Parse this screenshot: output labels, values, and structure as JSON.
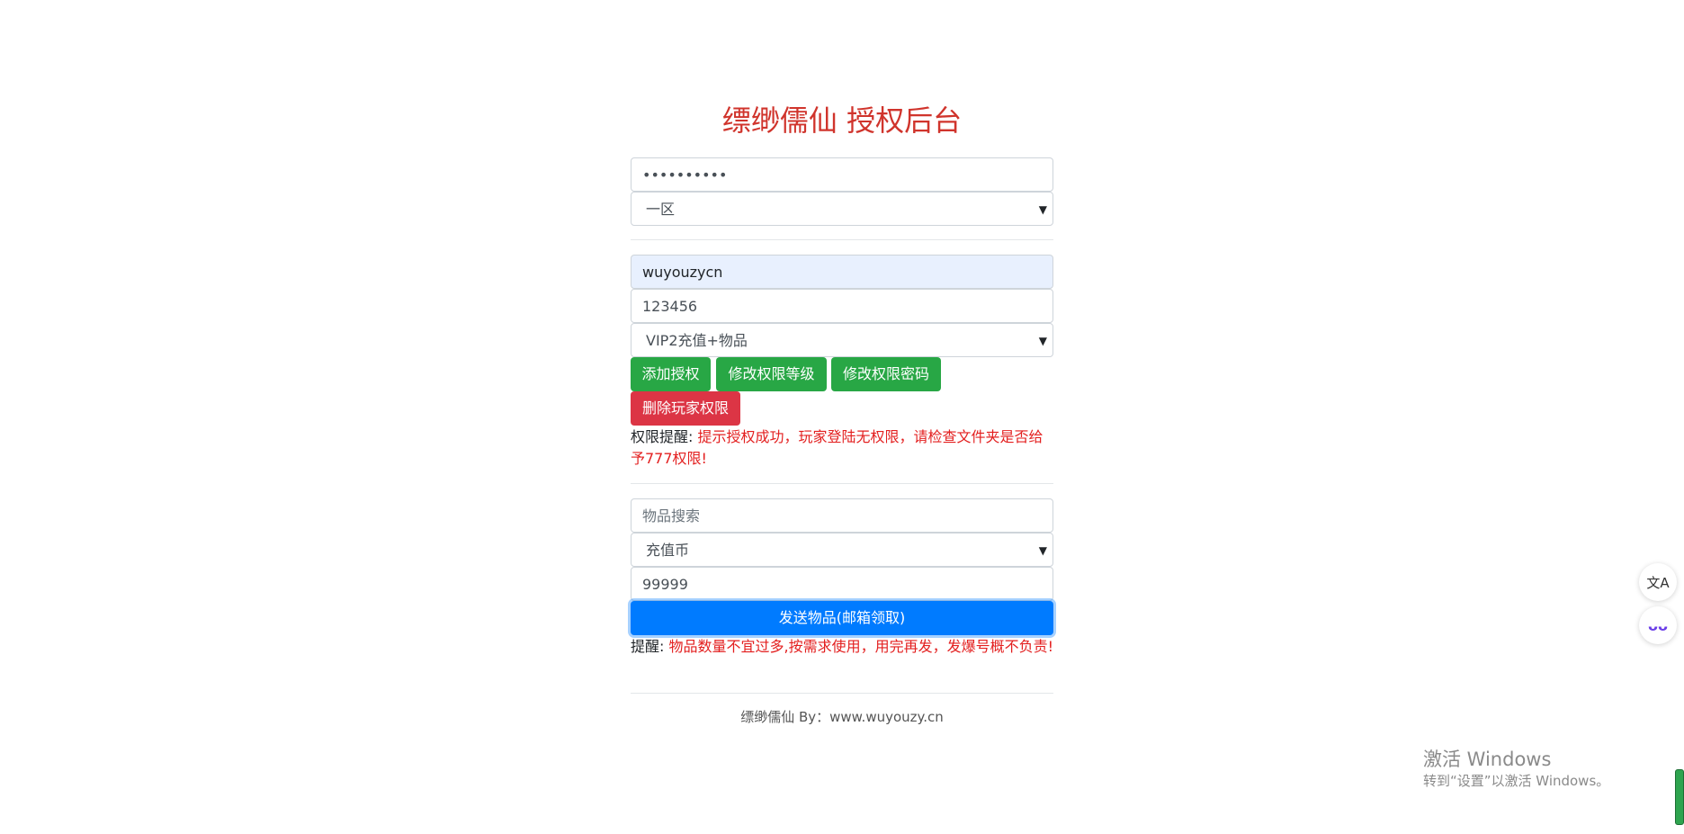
{
  "header": {
    "title": "缥缈儒仙 授权后台"
  },
  "auth": {
    "password_value": "••••••••••",
    "server_selected": "一区"
  },
  "permission": {
    "username_value": "wuyouzycn",
    "password_value": "123456",
    "level_selected": "VIP2充值+物品",
    "add_label": "添加授权",
    "modify_level_label": "修改权限等级",
    "modify_password_label": "修改权限密码",
    "delete_label": "删除玩家权限",
    "notice_prefix": "权限提醒:",
    "notice_text": "提示授权成功，玩家登陆无权限，请检查文件夹是否给予777权限!"
  },
  "items": {
    "search_placeholder": "物品搜索",
    "item_selected": "充值币",
    "quantity_value": "99999",
    "send_label": "发送物品(邮箱领取)",
    "notice_prefix": "提醒:",
    "notice_text": "物品数量不宜过多,按需求使用，用完再发，发爆号概不负责!"
  },
  "footer": {
    "text": "缥缈儒仙 By：www.wuyouzy.cn"
  },
  "sidebar_tools": {
    "translate_icon": "文A",
    "assistant_icon": "ᴗᴗ"
  },
  "watermark": {
    "line1": "激活 Windows",
    "line2": "转到“设置”以激活 Windows。"
  },
  "colors": {
    "title": "#d0342c",
    "green": "#28a745",
    "red": "#dc3545",
    "blue": "#007bff",
    "warning_text": "#e31f1f"
  }
}
